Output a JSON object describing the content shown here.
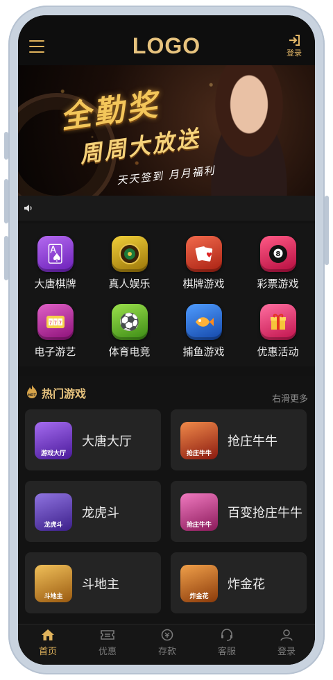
{
  "header": {
    "logo": "LOGO",
    "login_label": "登录"
  },
  "banner": {
    "title": "全勤奖",
    "subtitle": "周周大放送",
    "caption": "天天签到 月月福利"
  },
  "categories": [
    {
      "label": "大唐棋牌",
      "icon": "cards-icon",
      "color": "#8a3bd6"
    },
    {
      "label": "真人娱乐",
      "icon": "roulette-icon",
      "color": "#c59a12"
    },
    {
      "label": "棋牌游戏",
      "icon": "poker-icon",
      "color": "#d8402a"
    },
    {
      "label": "彩票游戏",
      "icon": "billiard-icon",
      "color": "#d81f5a"
    },
    {
      "label": "电子游艺",
      "icon": "slot-icon",
      "color": "#b8238f"
    },
    {
      "label": "体育电竞",
      "icon": "soccer-icon",
      "color": "#5aa52a"
    },
    {
      "label": "捕鱼游戏",
      "icon": "fish-icon",
      "color": "#2f6fd2"
    },
    {
      "label": "优惠活动",
      "icon": "gift-icon",
      "color": "#e0316d"
    }
  ],
  "hot": {
    "title": "热门游戏",
    "more": "右滑更多",
    "games": [
      {
        "name": "大唐大厅",
        "tag": "游戏大厅",
        "color": "#7b3fc7"
      },
      {
        "name": "抢庄牛牛",
        "tag": "抢庄牛牛",
        "color": "#b5321f"
      },
      {
        "name": "龙虎斗",
        "tag": "龙虎斗",
        "color": "#6a3fb0"
      },
      {
        "name": "百变抢庄牛牛",
        "tag": "抢庄牛牛",
        "color": "#c2408a"
      },
      {
        "name": "斗地主",
        "tag": "斗地主",
        "color": "#c48a1f"
      },
      {
        "name": "炸金花",
        "tag": "炸金花",
        "color": "#b85a1a"
      }
    ]
  },
  "tabs": [
    {
      "label": "首页",
      "icon": "home-icon"
    },
    {
      "label": "优惠",
      "icon": "ticket-icon"
    },
    {
      "label": "存款",
      "icon": "deposit-icon"
    },
    {
      "label": "客服",
      "icon": "support-icon"
    },
    {
      "label": "登录",
      "icon": "user-icon"
    }
  ],
  "colors": {
    "accent": "#e0b35c",
    "background": "#121212",
    "card": "#242424"
  }
}
